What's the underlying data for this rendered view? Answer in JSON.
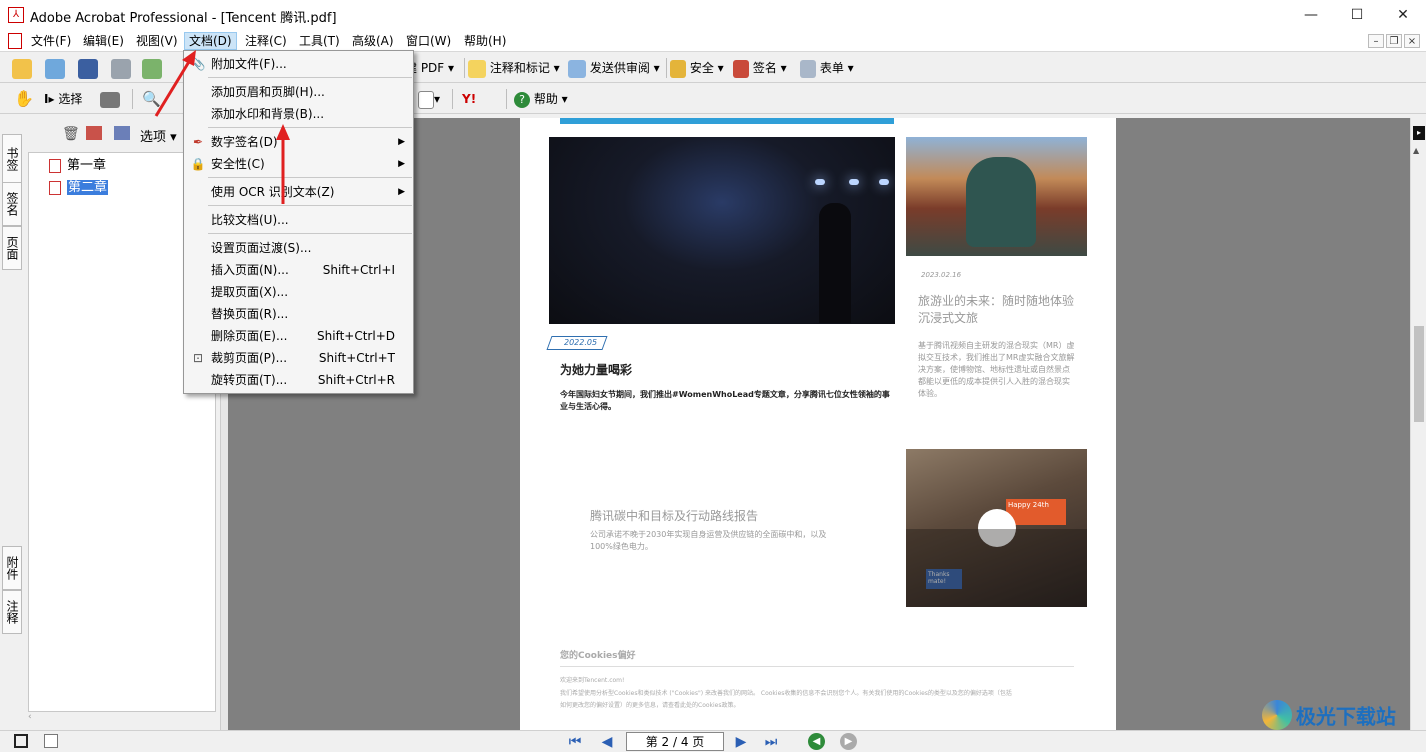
{
  "window": {
    "title": "Adobe Acrobat Professional - [Tencent 腾讯.pdf]",
    "minimize": "—",
    "maximize": "☐",
    "close": "✕"
  },
  "menubar": [
    "文件(F)",
    "编辑(E)",
    "视图(V)",
    "文档(D)",
    "注释(C)",
    "工具(T)",
    "高级(A)",
    "窗口(W)",
    "帮助(H)"
  ],
  "toolbar1": {
    "create_pdf": "建 PDF",
    "comment_markup": "注释和标记",
    "send_review": "发送供审阅",
    "security": "安全",
    "sign": "签名",
    "forms": "表单"
  },
  "toolbar2": {
    "select": "选择",
    "help": "帮助",
    "yahoo": "Y!"
  },
  "panel": {
    "options": "选项",
    "tabs": [
      "书签",
      "签名",
      "页面",
      "附件",
      "注释"
    ],
    "bookmarks": [
      {
        "label": "第一章",
        "selected": false
      },
      {
        "label": "第二章",
        "selected": true
      }
    ]
  },
  "document_menu": {
    "items": [
      {
        "label": "附加文件(F)...",
        "shortcut": "",
        "submenu": false,
        "icon": "paperclip-icon"
      },
      {
        "label": "添加页眉和页脚(H)...",
        "shortcut": "",
        "submenu": false,
        "icon": ""
      },
      {
        "label": "添加水印和背景(B)...",
        "shortcut": "",
        "submenu": false,
        "icon": ""
      },
      {
        "label": "数字签名(D)",
        "shortcut": "",
        "submenu": true,
        "icon": "pen-icon"
      },
      {
        "label": "安全性(C)",
        "shortcut": "",
        "submenu": true,
        "icon": "lock-icon"
      },
      {
        "label": "使用 OCR 识别文本(Z)",
        "shortcut": "",
        "submenu": true,
        "icon": ""
      },
      {
        "label": "比较文档(U)...",
        "shortcut": "",
        "submenu": false,
        "icon": ""
      },
      {
        "label": "设置页面过渡(S)...",
        "shortcut": "",
        "submenu": false,
        "icon": ""
      },
      {
        "label": "插入页面(N)...",
        "shortcut": "Shift+Ctrl+I",
        "submenu": false,
        "icon": ""
      },
      {
        "label": "提取页面(X)...",
        "shortcut": "",
        "submenu": false,
        "icon": ""
      },
      {
        "label": "替换页面(R)...",
        "shortcut": "",
        "submenu": false,
        "icon": ""
      },
      {
        "label": "删除页面(E)...",
        "shortcut": "Shift+Ctrl+D",
        "submenu": false,
        "icon": ""
      },
      {
        "label": "裁剪页面(P)...",
        "shortcut": "Shift+Ctrl+T",
        "submenu": false,
        "icon": "crop-icon"
      },
      {
        "label": "旋转页面(T)...",
        "shortcut": "Shift+Ctrl+R",
        "submenu": false,
        "icon": ""
      }
    ]
  },
  "page_content": {
    "article1_date": "2022.05",
    "article1_title": "为她力量喝彩",
    "article1_body": "今年国际妇女节期间，我们推出#WomenWhoLead专题文章，分享腾讯七位女性领袖的事\n业与生活心得。",
    "article2_date": "2023.02.16",
    "article2_title": "旅游业的未来：随时随地体验\n沉浸式文旅",
    "article2_body": "基于腾讯视频自主研发的混合现实（MR）虚\n拟交互技术，我们推出了MR虚实融合文旅解\n决方案，使博物馆、地标性遗址或自然景点\n都能以更低的成本提供引人入胜的混合现实\n体验。",
    "article3_title": "腾讯碳中和目标及行动路线报告",
    "article3_body": "公司承诺不晚于2030年实现自身运营及供应链的全面碳中和，以及\n100%绿色电力。",
    "sign1": "Happy 24th",
    "sign2": "Thanks mate!",
    "cookies_title": "您的Cookies偏好",
    "cookies_line1": "欢迎来到Tencent.com!",
    "cookies_line2": "我们希望使用分析型Cookies和类似技术 (\"Cookies\") 来改善我们的网站。 Cookies收集的信息不会识别您个人。有关我们使用的Cookies的类型以及您的偏好选项（包括",
    "cookies_line3": "如何更改您的偏好设置）的更多信息，请查看此处的Cookies政策。"
  },
  "statusbar": {
    "page_indicator": "第 2 / 4 页"
  },
  "watermark": "极光下载站",
  "colors": {
    "accent_blue": "#2f9fd8",
    "selection": "#3b7ddd",
    "arrow_red": "#e02020",
    "doc_bg": "#808080"
  }
}
